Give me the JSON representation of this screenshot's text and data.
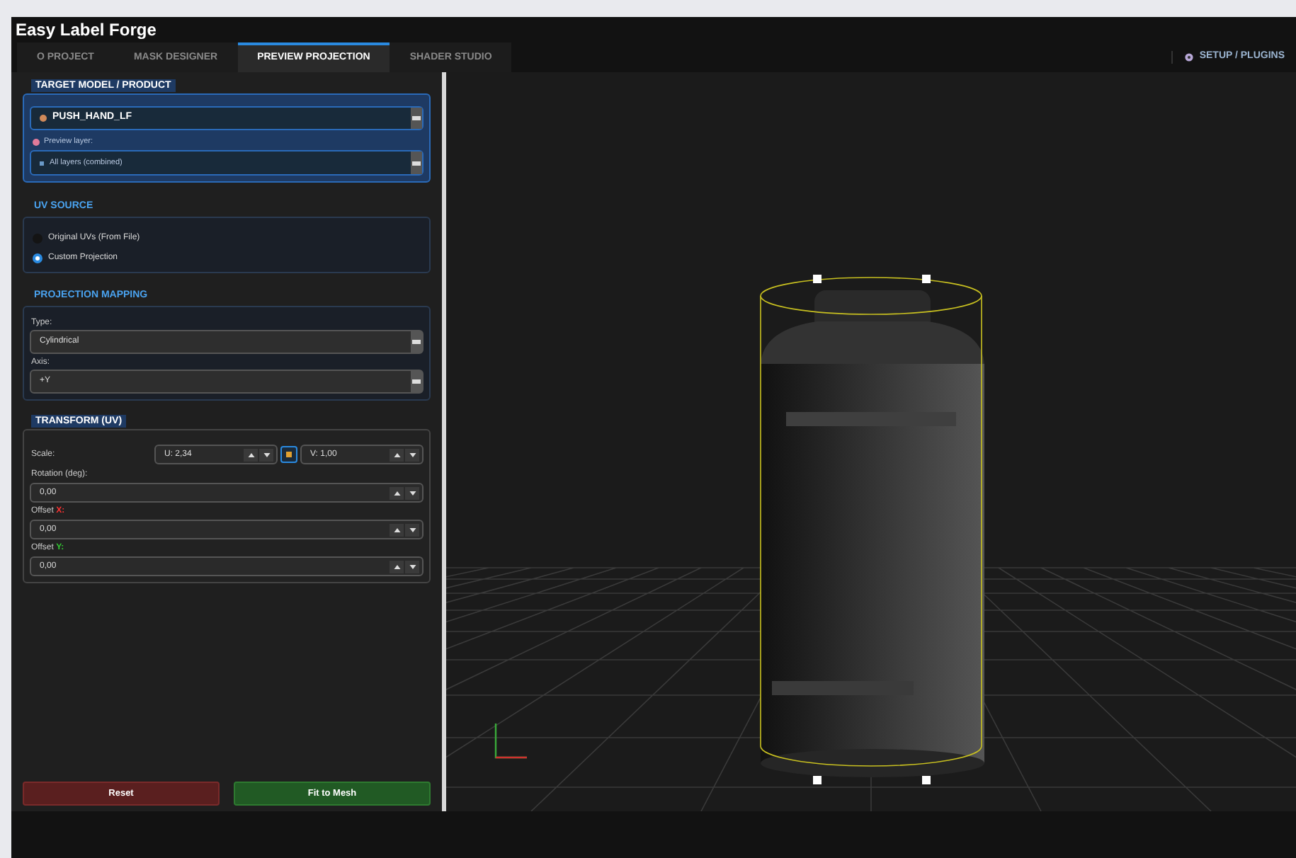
{
  "window": {
    "title": "Easy Label Forge"
  },
  "tabs": [
    {
      "label": "O PROJECT",
      "selected": false
    },
    {
      "label": "MASK DESIGNER",
      "selected": false
    },
    {
      "label": "PREVIEW PROJECTION",
      "selected": true
    },
    {
      "label": "SHADER STUDIO",
      "selected": false
    }
  ],
  "setup_button": {
    "label": "SETUP / PLUGINS"
  },
  "target_model": {
    "heading": "TARGET MODEL / PRODUCT",
    "model": "PUSH_HAND_LF",
    "layer_label": "Preview layer:",
    "layer": "All layers (combined)"
  },
  "uv_source": {
    "heading": "UV SOURCE",
    "options": [
      {
        "label": "Original UVs (From File)",
        "selected": false
      },
      {
        "label": "Custom Projection",
        "selected": true
      }
    ]
  },
  "projection_mapping": {
    "heading": "PROJECTION MAPPING",
    "fields": [
      {
        "label": "Type:",
        "value": "Cylindrical"
      },
      {
        "label": "Axis:",
        "value": "+Y"
      }
    ]
  },
  "transform": {
    "heading": "TRANSFORM (UV)",
    "scale_label": "Scale:",
    "scale_u": "U: 2,34",
    "scale_v": "V: 1,00",
    "locked": true,
    "fields": [
      {
        "label": "Rotation (deg):",
        "value": "0,00"
      },
      {
        "label": "Offset ",
        "axis": "X:",
        "color": "#ff3333",
        "value": "0,00"
      },
      {
        "label": "Offset ",
        "axis": "Y:",
        "color": "#33cc33",
        "value": "0,00"
      }
    ]
  },
  "buttons": [
    {
      "label": "Reset",
      "kind": "danger"
    },
    {
      "label": "Fit to Mesh",
      "kind": "primary"
    }
  ]
}
